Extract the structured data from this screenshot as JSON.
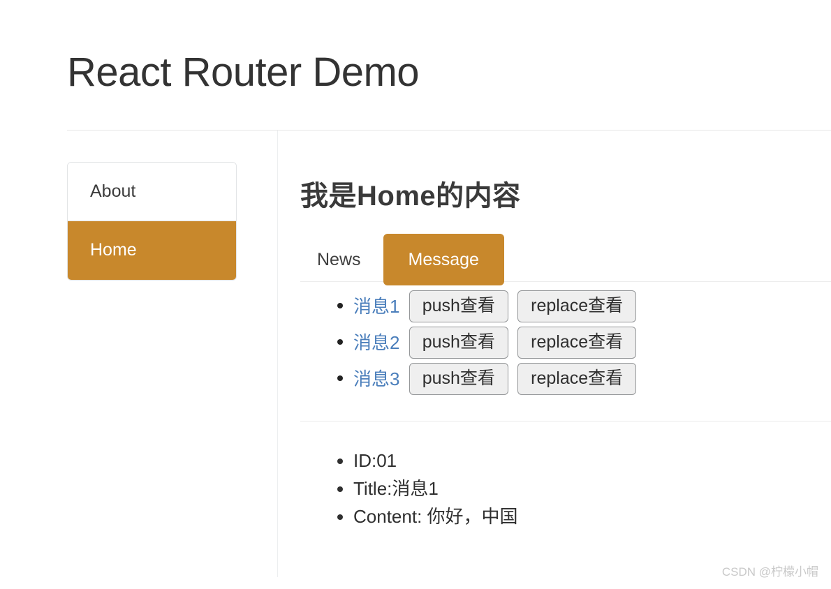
{
  "header": {
    "title": "React Router Demo"
  },
  "sidebar": {
    "items": [
      {
        "label": "About",
        "active": false
      },
      {
        "label": "Home",
        "active": true
      }
    ]
  },
  "content": {
    "heading": "我是Home的内容",
    "tabs": [
      {
        "label": "News",
        "active": false
      },
      {
        "label": "Message",
        "active": true
      }
    ],
    "messages": [
      {
        "link": "消息1",
        "push_label": "push查看",
        "replace_label": "replace查看"
      },
      {
        "link": "消息2",
        "push_label": "push查看",
        "replace_label": "replace查看"
      },
      {
        "link": "消息3",
        "push_label": "push查看",
        "replace_label": "replace查看"
      }
    ],
    "detail": [
      "ID:01",
      "Title:消息1",
      "Content: 你好，中国"
    ]
  },
  "watermark": {
    "text": "CSDN @柠檬小帽"
  },
  "colors": {
    "accent": "#c8882c",
    "link": "#4a7ebb",
    "text": "#333333",
    "border": "#e2e4e6",
    "button_bg": "#efefef"
  }
}
